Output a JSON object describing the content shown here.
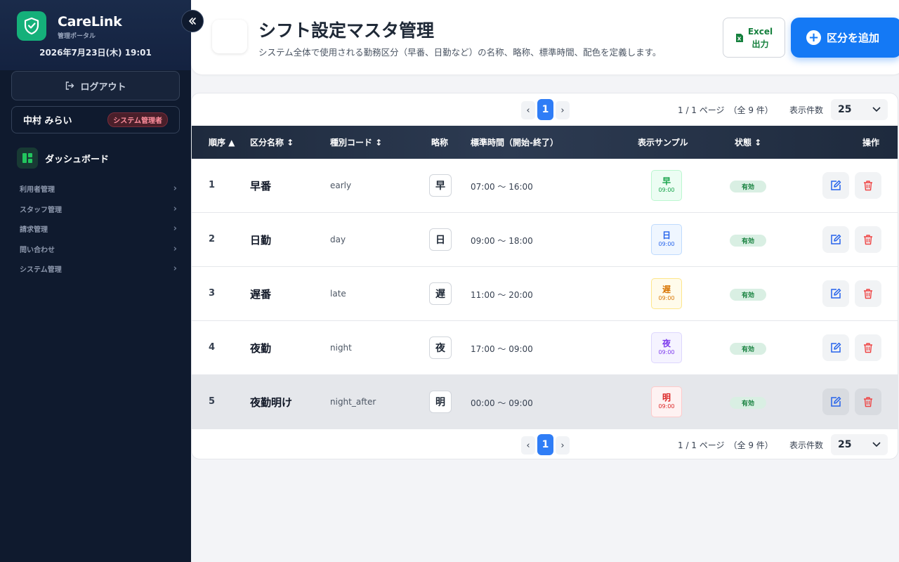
{
  "sidebar": {
    "brand": "CareLink",
    "brand_sub": "管理ポータル",
    "datetime": "2026年7月23日(木) 19:01",
    "logout_label": "ログアウト",
    "user_name": "中村 みらい",
    "user_role": "システム管理者",
    "dashboard_label": "ダッシュボード",
    "nav": [
      "利用者管理",
      "スタッフ管理",
      "請求管理",
      "問い合わせ",
      "システム管理"
    ],
    "accent_color": "#15b07a"
  },
  "header": {
    "title": "シフト設定マスタ管理",
    "description": "システム全体で使用される勤務区分（早番、日勤など）の名称、略称、標準時間、配色を定義します。",
    "excel_label_1": "Excel",
    "excel_label_2": "出力",
    "add_label": "区分を追加"
  },
  "pager": {
    "prev": "‹",
    "current": "1",
    "next": "›",
    "info": "1 / 1 ページ　（全 9 件）",
    "size_label": "表示件数",
    "size_value": "25"
  },
  "table": {
    "headers": {
      "order": "順序 ▲",
      "name": "区分名称 ↕",
      "code": "種別コード ↕",
      "abbr": "略称",
      "time": "標準時間（開始-終了）",
      "sample": "表示サンプル",
      "status": "状態 ↕",
      "actions": "操作"
    },
    "rows": [
      {
        "order": "1",
        "name": "早番",
        "code": "early",
        "abbr": "早",
        "time": "07:00 〜 16:00",
        "sample_char": "早",
        "sample_time": "09:00",
        "status": "有効",
        "color": "#16a34a",
        "bg": "#ecfdf3",
        "border": "#bbf7d0"
      },
      {
        "order": "2",
        "name": "日勤",
        "code": "day",
        "abbr": "日",
        "time": "09:00 〜 18:00",
        "sample_char": "日",
        "sample_time": "09:00",
        "status": "有効",
        "color": "#2563eb",
        "bg": "#eff6ff",
        "border": "#bfdbfe"
      },
      {
        "order": "3",
        "name": "遅番",
        "code": "late",
        "abbr": "遅",
        "time": "11:00 〜 20:00",
        "sample_char": "遅",
        "sample_time": "09:00",
        "status": "有効",
        "color": "#d97706",
        "bg": "#fffbeb",
        "border": "#fde68a"
      },
      {
        "order": "4",
        "name": "夜勤",
        "code": "night",
        "abbr": "夜",
        "time": "17:00 〜 09:00",
        "sample_char": "夜",
        "sample_time": "09:00",
        "status": "有効",
        "color": "#7c3aed",
        "bg": "#f5f3ff",
        "border": "#ddd6fe"
      },
      {
        "order": "5",
        "name": "夜勤明け",
        "code": "night_after",
        "abbr": "明",
        "time": "00:00 〜 09:00",
        "sample_char": "明",
        "sample_time": "09:00",
        "status": "有効",
        "color": "#dc2626",
        "bg": "#fef2f2",
        "border": "#fecaca"
      }
    ]
  }
}
